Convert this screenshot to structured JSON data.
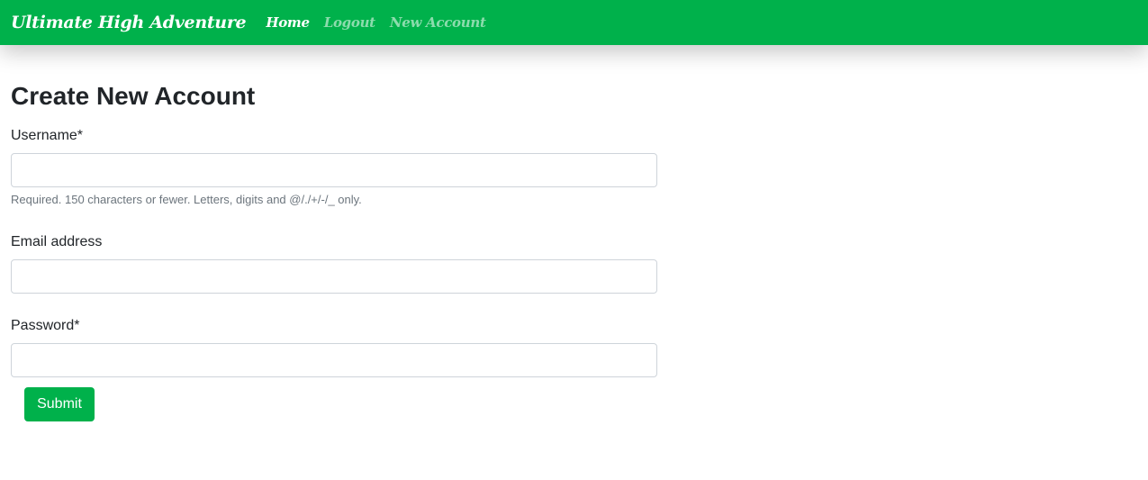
{
  "navbar": {
    "brand": "Ultimate High Adventure",
    "links": [
      {
        "label": "Home"
      },
      {
        "label": "Logout"
      },
      {
        "label": "New Account"
      }
    ],
    "colors": {
      "background": "#00b14b",
      "active": "#ffffff"
    }
  },
  "page": {
    "title": "Create New Account"
  },
  "form": {
    "username": {
      "label": "Username*",
      "value": "",
      "help": "Required. 150 characters or fewer. Letters, digits and @/./+/-/_ only."
    },
    "email": {
      "label": "Email address",
      "value": ""
    },
    "password": {
      "label": "Password*",
      "value": ""
    },
    "submit_label": "Submit"
  }
}
